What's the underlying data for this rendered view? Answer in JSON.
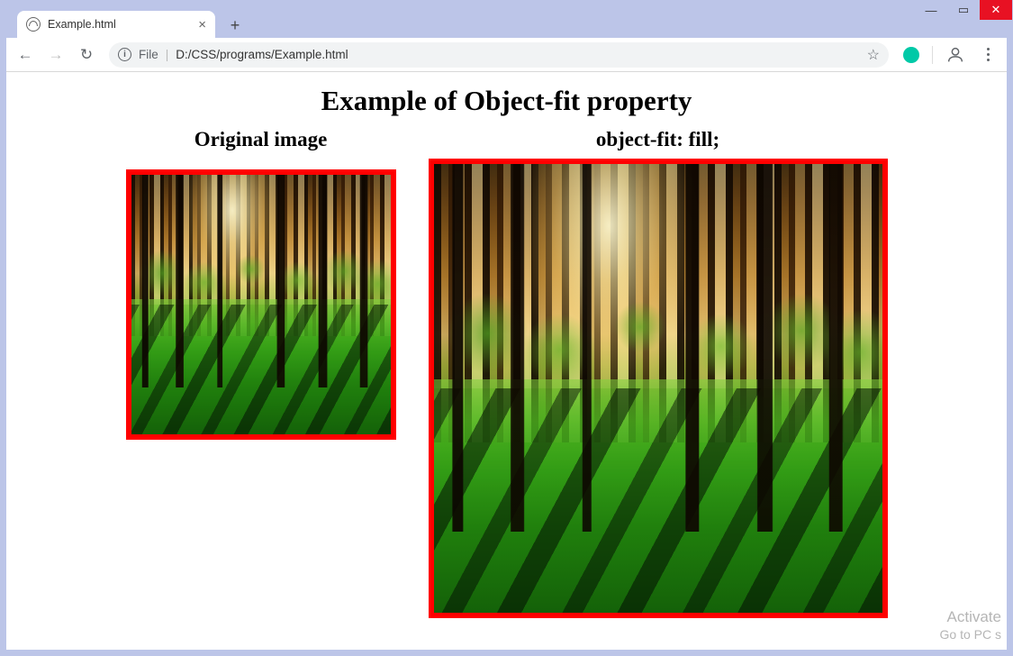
{
  "window": {
    "minimize": "—",
    "maximize": "▭",
    "close": "✕"
  },
  "tab": {
    "title": "Example.html",
    "close": "×",
    "newtab": "+"
  },
  "toolbar": {
    "back": "←",
    "forward": "→",
    "reload": "↻",
    "info_icon": "i",
    "file_label": "File",
    "separator": "|",
    "path": "D:/CSS/programs/Example.html",
    "star": "☆"
  },
  "page": {
    "heading": "Example of Object-fit property",
    "original_label": "Original image",
    "fill_label": "object-fit: fill;"
  },
  "watermark": {
    "line1": "Activate",
    "line2": "Go to PC s"
  }
}
